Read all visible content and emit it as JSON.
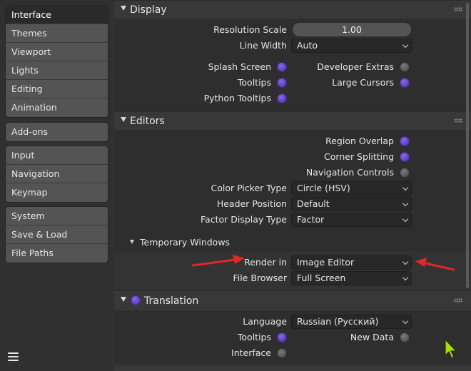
{
  "sidebar": {
    "groups": [
      [
        "Interface",
        "Themes",
        "Viewport",
        "Lights",
        "Editing",
        "Animation"
      ],
      [
        "Add-ons"
      ],
      [
        "Input",
        "Navigation",
        "Keymap"
      ],
      [
        "System",
        "Save & Load",
        "File Paths"
      ]
    ],
    "active": "Interface"
  },
  "display": {
    "title": "Display",
    "resolution_scale_label": "Resolution Scale",
    "resolution_scale_value": "1.00",
    "line_width_label": "Line Width",
    "line_width_value": "Auto",
    "splash_screen_label": "Splash Screen",
    "splash_screen_on": true,
    "developer_extras_label": "Developer Extras",
    "developer_extras_on": false,
    "tooltips_label": "Tooltips",
    "tooltips_on": true,
    "large_cursors_label": "Large Cursors",
    "large_cursors_on": true,
    "python_tooltips_label": "Python Tooltips",
    "python_tooltips_on": true
  },
  "editors": {
    "title": "Editors",
    "region_overlap_label": "Region Overlap",
    "region_overlap_on": true,
    "corner_splitting_label": "Corner Splitting",
    "corner_splitting_on": true,
    "navigation_controls_label": "Navigation Controls",
    "navigation_controls_on": false,
    "color_picker_type_label": "Color Picker Type",
    "color_picker_type_value": "Circle (HSV)",
    "header_position_label": "Header Position",
    "header_position_value": "Default",
    "factor_display_type_label": "Factor Display Type",
    "factor_display_type_value": "Factor",
    "temporary_windows": {
      "title": "Temporary Windows",
      "render_in_label": "Render in",
      "render_in_value": "Image Editor",
      "file_browser_label": "File Browser",
      "file_browser_value": "Full Screen"
    }
  },
  "translation": {
    "title": "Translation",
    "enabled": true,
    "language_label": "Language",
    "language_value": "Russian (Русский)",
    "tooltips_label": "Tooltips",
    "tooltips_on": true,
    "new_data_label": "New Data",
    "new_data_on": false,
    "interface_label": "Interface",
    "interface_on": false
  },
  "colors": {
    "accent_on": "#6a4bd0",
    "annotation_arrow": "#e02828"
  }
}
